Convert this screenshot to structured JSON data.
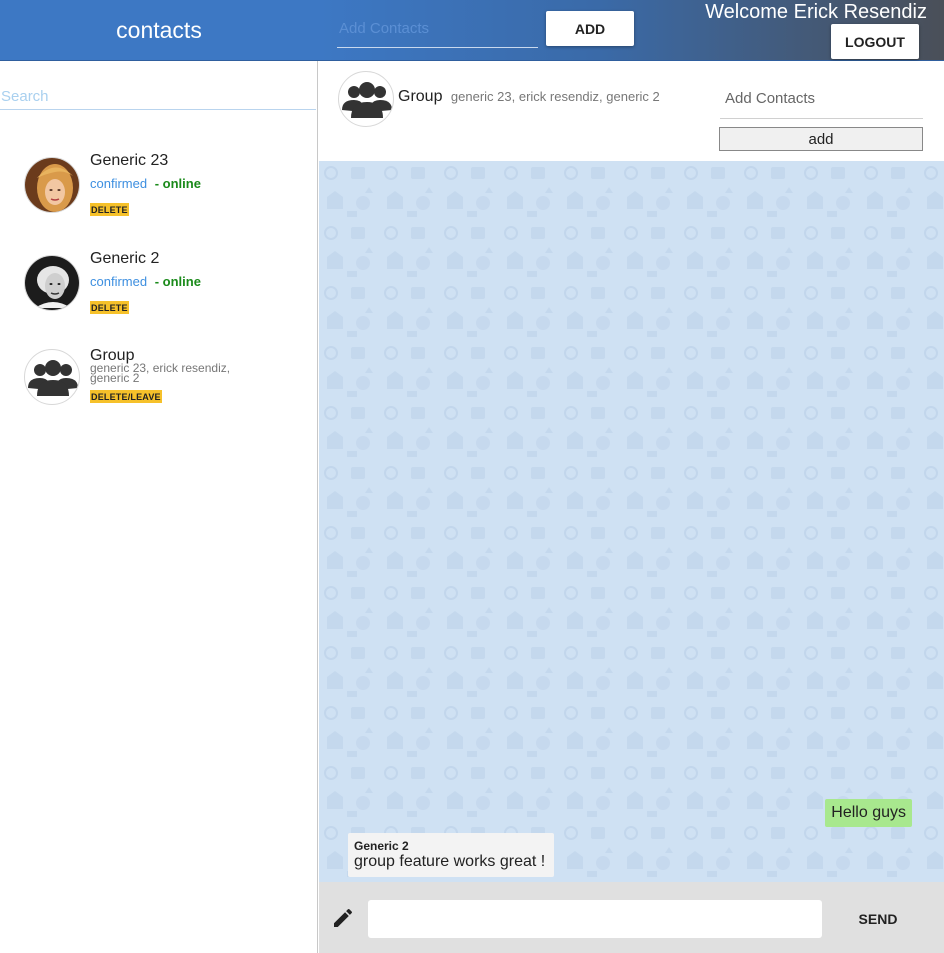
{
  "sidebar": {
    "title": "contacts",
    "search_placeholder": "Search",
    "contacts": [
      {
        "name": "Generic 23",
        "status": "confirmed",
        "presence": "- online",
        "action": "DELETE"
      },
      {
        "name": "Generic 2",
        "status": "confirmed",
        "presence": "- online",
        "action": "DELETE"
      },
      {
        "name": "Group",
        "members": "generic 23, erick resendiz, generic 2",
        "action": "DELETE/LEAVE"
      }
    ]
  },
  "topbar": {
    "add_contacts_placeholder": "Add Contacts",
    "add_label": "ADD",
    "welcome": "Welcome Erick Resendiz",
    "logout_label": "LOGOUT"
  },
  "chat": {
    "title": "Group",
    "members": "generic 23, erick resendiz, generic 2",
    "add_contacts_placeholder": "Add Contacts",
    "add_label": "add",
    "messages": [
      {
        "direction": "out",
        "text": "Hello guys"
      },
      {
        "direction": "in",
        "author": "Generic 2",
        "text": "group feature works great !"
      }
    ]
  },
  "composer": {
    "send_label": "SEND"
  },
  "icons": {
    "group_avatar": "group-icon",
    "edit": "pencil-icon"
  },
  "colors": {
    "header_blue": "#3d78c4",
    "chat_background": "#cfe1f3",
    "outgoing_bubble": "#a8e88e",
    "badge": "#f6c12a",
    "confirmed": "#3d8fe0",
    "online": "#1a8a1a"
  }
}
